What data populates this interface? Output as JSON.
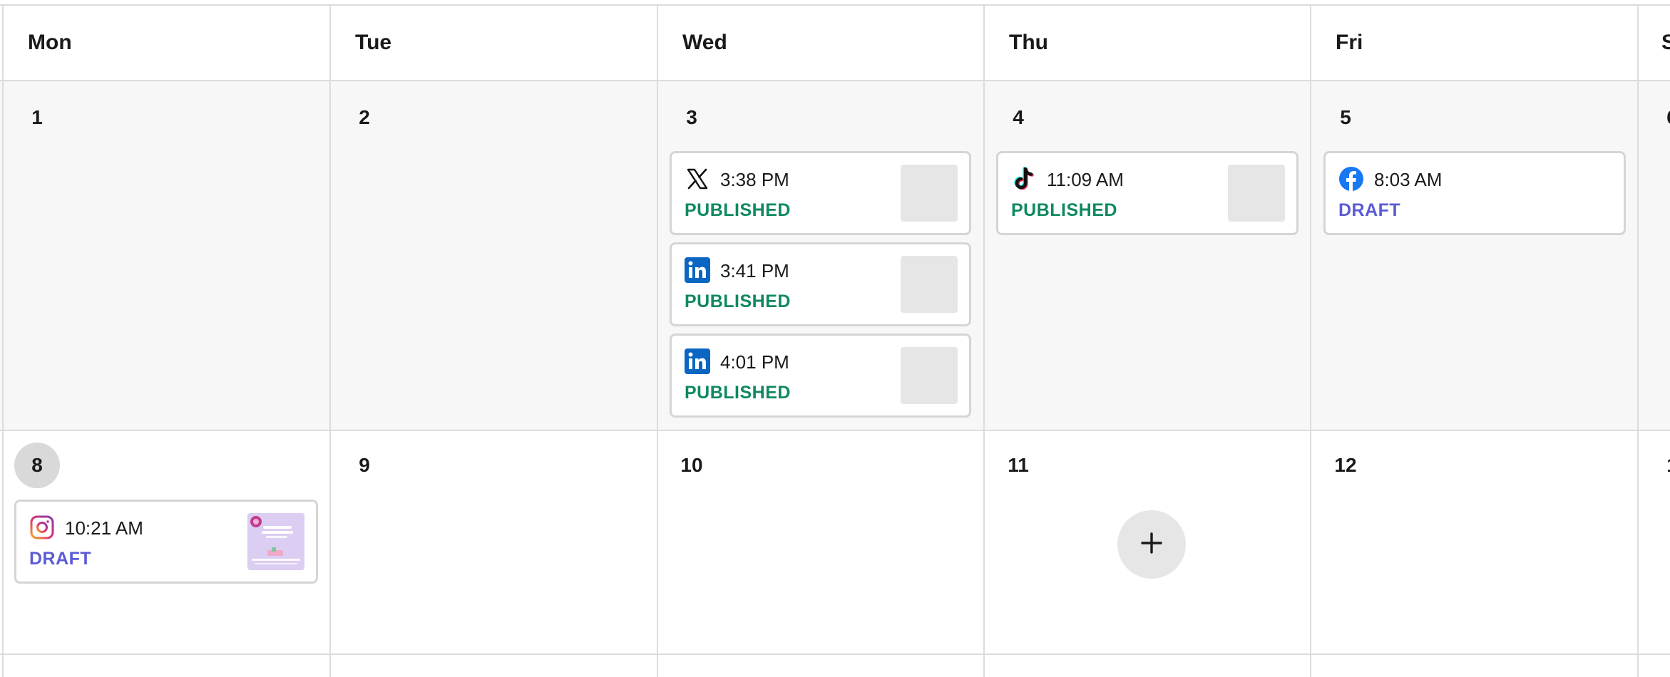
{
  "weekdays": [
    "Mon",
    "Tue",
    "Wed",
    "Thu",
    "Fri",
    "S"
  ],
  "week1": {
    "days": [
      "1",
      "2",
      "3",
      "4",
      "5",
      "6"
    ]
  },
  "week2": {
    "days": [
      "8",
      "9",
      "10",
      "11",
      "12",
      "1"
    ],
    "today": "8"
  },
  "posts": {
    "wed3_x": {
      "network": "x-icon",
      "time": "3:38 PM",
      "status": "PUBLISHED"
    },
    "wed3_li1": {
      "network": "linkedin-icon",
      "time": "3:41 PM",
      "status": "PUBLISHED"
    },
    "wed3_li2": {
      "network": "linkedin-icon",
      "time": "4:01 PM",
      "status": "PUBLISHED"
    },
    "thu4_tt": {
      "network": "tiktok-icon",
      "time": "11:09 AM",
      "status": "PUBLISHED"
    },
    "fri5_fb": {
      "network": "facebook-icon",
      "time": "8:03 AM",
      "status": "DRAFT"
    },
    "mon8_ig": {
      "network": "instagram-icon",
      "time": "10:21 AM",
      "status": "DRAFT"
    }
  },
  "add_button": {
    "icon": "plus-icon"
  },
  "colors": {
    "published": "#0f8a5f",
    "draft": "#5b5bd6",
    "linkedin": "#0a66c2",
    "facebook": "#1877f2"
  }
}
